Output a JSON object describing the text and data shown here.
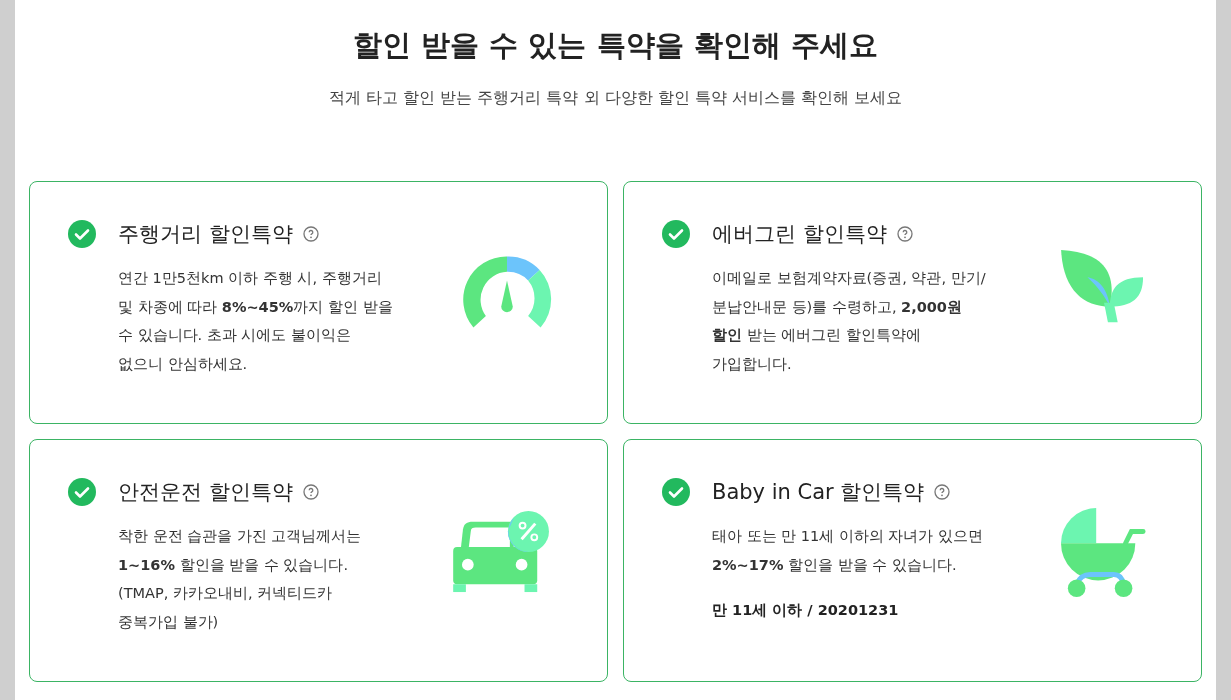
{
  "heading": "할인 받을 수 있는 특약을 확인해 주세요",
  "subheading": "적게 타고 할인 받는 주행거리 특약 외 다양한 할인 특약 서비스를 확인해 보세요",
  "cards": [
    {
      "title": "주행거리 할인특약",
      "kind": "gauge",
      "lines": [
        "연간 1만5천km 이하 주행 시, 주행거리",
        "및 차종에 따라 **8%~45%**까지 할인 받을",
        "수 있습니다. 초과 시에도 불이익은",
        "없으니 안심하세요."
      ]
    },
    {
      "title": "에버그린 할인특약",
      "kind": "leaf",
      "lines": [
        "이메일로 보험계약자료(증권, 약관, 만기/",
        "분납안내문 등)를 수령하고, **2,000원**",
        "**할인** 받는 에버그린 할인특약에",
        "가입합니다."
      ]
    },
    {
      "title": "안전운전 할인특약",
      "kind": "car",
      "lines": [
        "착한 운전 습관을 가진 고객님께서는",
        "**1~16%** 할인을 받을 수 있습니다.",
        "(TMAP, 카카오내비, 커넥티드카",
        "중복가입 불가)"
      ]
    },
    {
      "title": "Baby in Car 할인특약",
      "kind": "stroller",
      "lines": [
        "태아 또는 만 11세 이하의 자녀가 있으면",
        "**2%~17%** 할인을 받을 수 있습니다."
      ],
      "note": "만 11세 이하 / 20201231"
    }
  ]
}
